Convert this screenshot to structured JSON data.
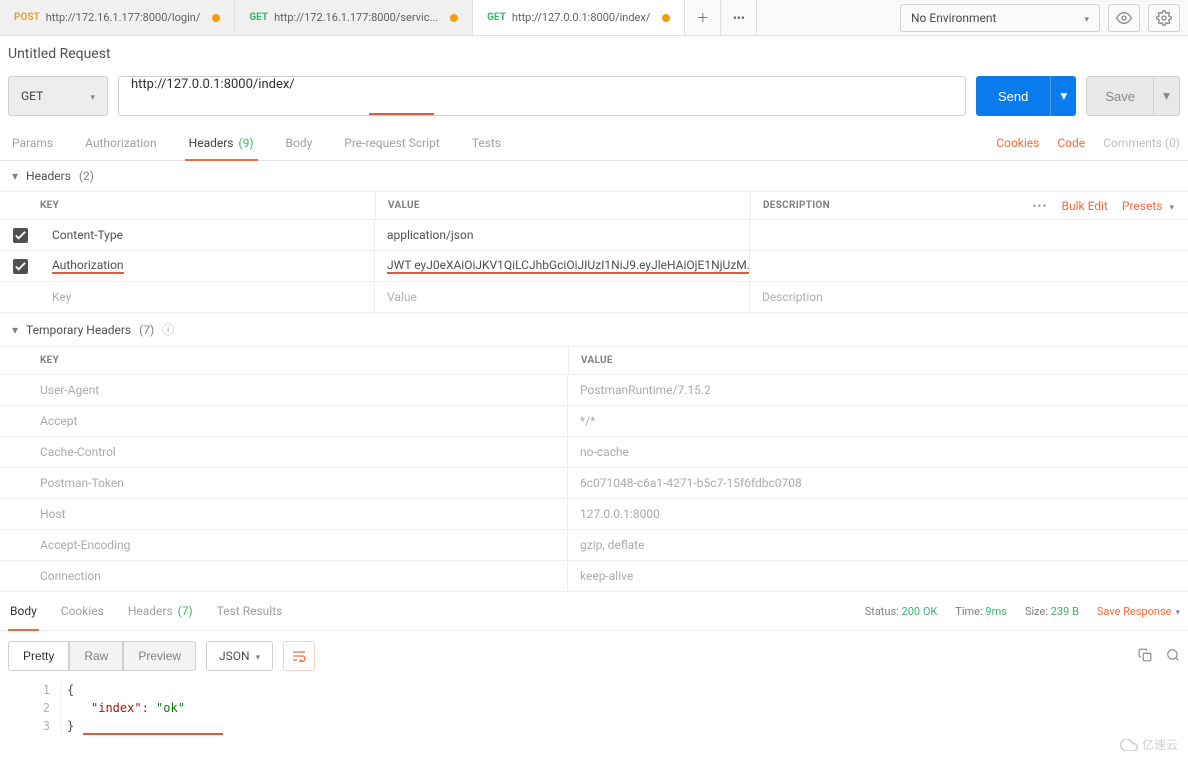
{
  "tabs": [
    {
      "method": "POST",
      "methodClass": "method-post",
      "url": "http://172.16.1.177:8000/login/",
      "dirty": true,
      "active": false
    },
    {
      "method": "GET",
      "methodClass": "method-get",
      "url": "http://172.16.1.177:8000/servic...",
      "dirty": true,
      "active": false
    },
    {
      "method": "GET",
      "methodClass": "method-get",
      "url": "http://127.0.0.1:8000/index/",
      "dirty": true,
      "active": true
    }
  ],
  "environment": "No Environment",
  "requestTitle": "Untitled Request",
  "method": "GET",
  "url": "http://127.0.0.1:8000/index/",
  "sendLabel": "Send",
  "saveLabel": "Save",
  "reqTabs": {
    "params": "Params",
    "auth": "Authorization",
    "headers": "Headers",
    "headersCount": "(9)",
    "body": "Body",
    "prereq": "Pre-request Script",
    "tests": "Tests"
  },
  "reqRightLinks": {
    "cookies": "Cookies",
    "code": "Code",
    "comments": "Comments (0)"
  },
  "headersSection": {
    "title": "Headers",
    "count": "(2)"
  },
  "kvColumns": {
    "key": "KEY",
    "value": "VALUE",
    "desc": "DESCRIPTION"
  },
  "kvActions": {
    "bulk": "Bulk Edit",
    "presets": "Presets"
  },
  "headers": [
    {
      "key": "Content-Type",
      "value": "application/json",
      "checked": true,
      "underlineKey": false,
      "underlineVal": false
    },
    {
      "key": "Authorization",
      "value": "JWT  eyJ0eXAiOiJKV1QiLCJhbGciOiJIUzI1NiJ9.eyJleHAiOjE1NjUzM...",
      "checked": true,
      "underlineKey": true,
      "underlineVal": true
    }
  ],
  "blankRow": {
    "key": "Key",
    "value": "Value",
    "desc": "Description"
  },
  "tempHeadersSection": {
    "title": "Temporary Headers",
    "count": "(7)"
  },
  "tempHeaders": [
    {
      "key": "User-Agent",
      "value": "PostmanRuntime/7.15.2"
    },
    {
      "key": "Accept",
      "value": "*/*"
    },
    {
      "key": "Cache-Control",
      "value": "no-cache"
    },
    {
      "key": "Postman-Token",
      "value": "6c071048-c6a1-4271-b5c7-15f6fdbc0708"
    },
    {
      "key": "Host",
      "value": "127.0.0.1:8000"
    },
    {
      "key": "Accept-Encoding",
      "value": "gzip, deflate"
    },
    {
      "key": "Connection",
      "value": "keep-alive"
    }
  ],
  "respTabs": {
    "body": "Body",
    "cookies": "Cookies",
    "headers": "Headers",
    "headersCount": "(7)",
    "testResults": "Test Results"
  },
  "respMeta": {
    "statusLabel": "Status:",
    "statusVal": "200 OK",
    "timeLabel": "Time:",
    "timeVal": "9ms",
    "sizeLabel": "Size:",
    "sizeVal": "239 B",
    "saveResponse": "Save Response"
  },
  "viewModes": {
    "pretty": "Pretty",
    "raw": "Raw",
    "preview": "Preview",
    "format": "JSON"
  },
  "jsonBody": {
    "lines": [
      "1",
      "2",
      "3"
    ],
    "line1": "{",
    "line2_key": "\"index\"",
    "line2_colon": ": ",
    "line2_val": "\"ok\"",
    "line3": "}"
  },
  "watermark": "亿速云"
}
